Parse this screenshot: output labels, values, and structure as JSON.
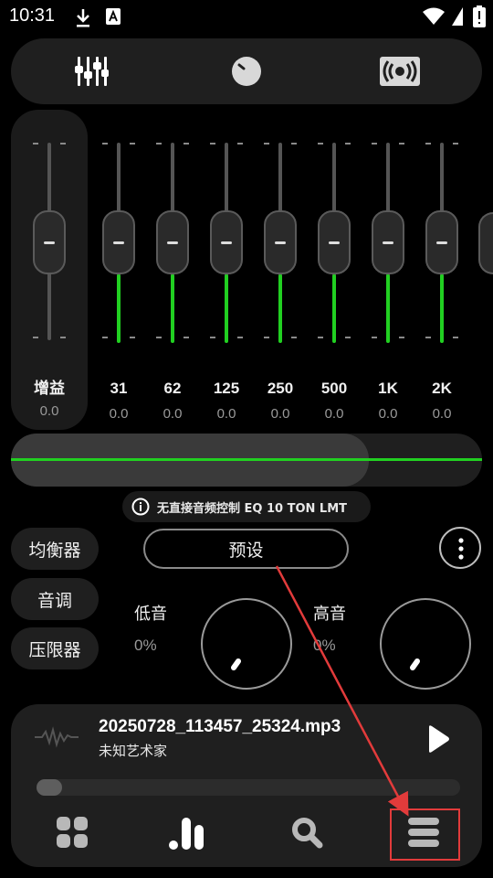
{
  "status_bar": {
    "time": "10:31"
  },
  "eq": {
    "gain": {
      "label": "增益",
      "value": "0.0"
    },
    "bands": [
      {
        "label": "31",
        "value": "0.0"
      },
      {
        "label": "62",
        "value": "0.0"
      },
      {
        "label": "125",
        "value": "0.0"
      },
      {
        "label": "250",
        "value": "0.0"
      },
      {
        "label": "500",
        "value": "0.0"
      },
      {
        "label": "1K",
        "value": "0.0"
      },
      {
        "label": "2K",
        "value": "0.0"
      }
    ]
  },
  "info_chip": {
    "text": "无直接音频控制 EQ 10 TON LMT"
  },
  "side_buttons": {
    "equalizer": "均衡器",
    "tone": "音调",
    "limiter": "压限器"
  },
  "preset_button": "预设",
  "tone": {
    "bass": {
      "label": "低音",
      "value": "0%"
    },
    "treble": {
      "label": "高音",
      "value": "0%"
    }
  },
  "player": {
    "title": "20250728_113457_25324.mp3",
    "artist": "未知艺术家",
    "progress": 0.05
  },
  "colors": {
    "accent": "#21d021",
    "annotation": "#e23b3b",
    "background": "#000000"
  }
}
